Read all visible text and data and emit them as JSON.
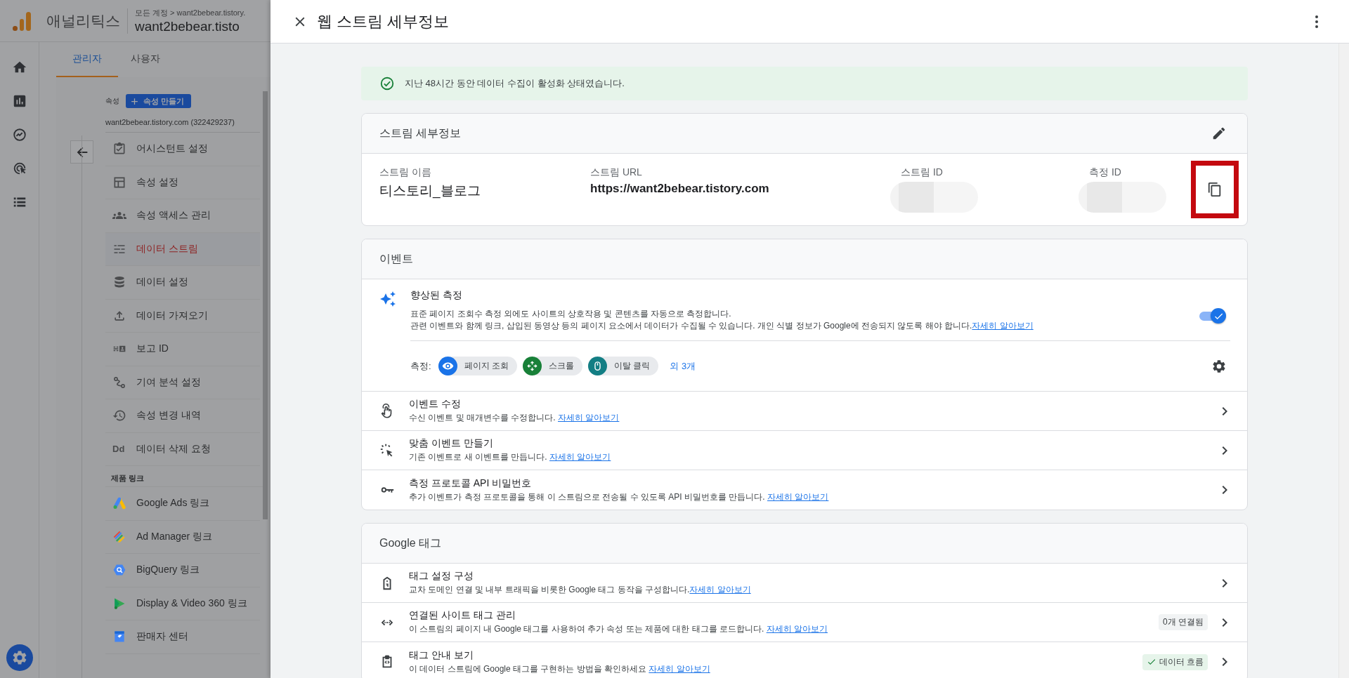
{
  "app": {
    "name": "애널리틱스",
    "breadcrumb": "모든 계정 > want2bebear.tistory.",
    "property_title": "want2bebear.tisto"
  },
  "nav_rail": [
    {
      "kind": "home",
      "selected": false
    },
    {
      "kind": "reports",
      "selected": false
    },
    {
      "kind": "explore",
      "selected": false
    },
    {
      "kind": "advertising",
      "selected": false
    },
    {
      "kind": "list",
      "selected": false
    }
  ],
  "tabs": [
    {
      "label": "관리자",
      "selected": true
    },
    {
      "label": "사용자",
      "selected": false
    }
  ],
  "property": {
    "label": "속성",
    "create_button": "속성 만들기",
    "account": "want2bebear.tistory.com (322429237)"
  },
  "menu": [
    {
      "kind": "clipboard",
      "label": "어시스턴트 설정",
      "selected": false
    },
    {
      "kind": "layout",
      "label": "속성 설정",
      "selected": false
    },
    {
      "kind": "people",
      "label": "속성 액세스 관리",
      "selected": false
    },
    {
      "kind": "stream",
      "label": "데이터 스트림",
      "selected": true
    },
    {
      "kind": "database",
      "label": "데이터 설정",
      "selected": false
    },
    {
      "kind": "upload",
      "label": "데이터 가져오기",
      "selected": false
    },
    {
      "kind": "reportid",
      "label": "보고 ID",
      "selected": false
    },
    {
      "kind": "path",
      "label": "기여 분석 설정",
      "selected": false
    },
    {
      "kind": "history",
      "label": "속성 변경 내역",
      "selected": false
    },
    {
      "kind": "text",
      "icon_text": "Dd",
      "label": "데이터 삭제 요청",
      "selected": false
    }
  ],
  "links_section": {
    "title": "제품 링크",
    "items": [
      {
        "kind": "ads",
        "label": "Google Ads 링크"
      },
      {
        "kind": "admanager",
        "label": "Ad Manager 링크"
      },
      {
        "kind": "bigquery",
        "label": "BigQuery 링크"
      },
      {
        "kind": "dv360",
        "label": "Display & Video 360 링크"
      },
      {
        "kind": "merchant",
        "label": "판매자 센터"
      }
    ]
  },
  "panel": {
    "title": "웹 스트림 세부정보"
  },
  "banner": "지난 48시간 동안 데이터 수집이 활성화 상태였습니다.",
  "stream_details": {
    "title": "스트림 세부정보",
    "fields": [
      {
        "label": "스트림 이름",
        "value": "티스토리_블로그",
        "kind": "text"
      },
      {
        "label": "스트림 URL",
        "value": "https://want2bebear.tistory.com",
        "kind": "url"
      },
      {
        "label": "스트림 ID",
        "kind": "redacted"
      },
      {
        "label": "측정 ID",
        "kind": "redacted"
      }
    ],
    "copy_highlighted": true
  },
  "events": {
    "title": "이벤트",
    "enhanced": {
      "title": "향상된 측정",
      "lines": [
        "표준 페이지 조회수 측정 외에도 사이트의 상호작용 및 콘텐츠를 자동으로 측정합니다.",
        "관련 이벤트와 함께 링크, 삽입된 동영상 등의 페이지 요소에서 데이터가 수집될 수 있습니다. 개인 식별 정보가 Google에 전송되지 않도록 해야 합니다."
      ],
      "link": "자세히 알아보기",
      "on": true,
      "measure_label": "측정:",
      "chips": [
        {
          "kind": "eye",
          "label": "페이지 조회",
          "color": "#1a73e8"
        },
        {
          "kind": "scroll",
          "label": "스크롤",
          "color": "#188038"
        },
        {
          "kind": "mouse",
          "label": "이탈 클릭",
          "color": "#137e84"
        }
      ],
      "more": "외 3개"
    },
    "rows": [
      {
        "kind": "touch",
        "title": "이벤트 수정",
        "description": "수신 이벤트 및 매개변수를 수정합니다. ",
        "link": "자세히 알아보기"
      },
      {
        "kind": "click",
        "title": "맞춤 이벤트 만들기",
        "description": "기존 이벤트로 새 이벤트를 만듭니다. ",
        "link": "자세히 알아보기"
      },
      {
        "kind": "key",
        "title": "측정 프로토콜 API 비밀번호",
        "description": "추가 이벤트가 측정 프로토콜을 통해 이 스트림으로 전송될 수 있도록 API 비밀번호를 만듭니다. ",
        "link": "자세히 알아보기"
      }
    ]
  },
  "google_tag": {
    "title": "Google 태그",
    "rows": [
      {
        "kind": "tag",
        "title": "태그 설정 구성",
        "description": "교차 도메인 연결 및 내부 트래픽을 비롯한 Google 태그 동작을 구성합니다.",
        "link": "자세히 알아보기"
      },
      {
        "kind": "code",
        "title": "연결된 사이트 태그 관리",
        "description": "이 스트림의 페이지 내 Google 태그를 사용하여 추가 속성 또는 제품에 대한 태그를 로드합니다. ",
        "link": "자세히 알아보기",
        "badge": {
          "label": "0개 연결됨",
          "kind": "plain"
        }
      },
      {
        "kind": "guide",
        "title": "태그 안내 보기",
        "description": "이 데이터 스트림에 Google 태그를 구현하는 방법을 확인하세요 ",
        "link": "자세히 알아보기",
        "badge": {
          "label": "데이터 흐름",
          "kind": "success"
        }
      }
    ]
  }
}
